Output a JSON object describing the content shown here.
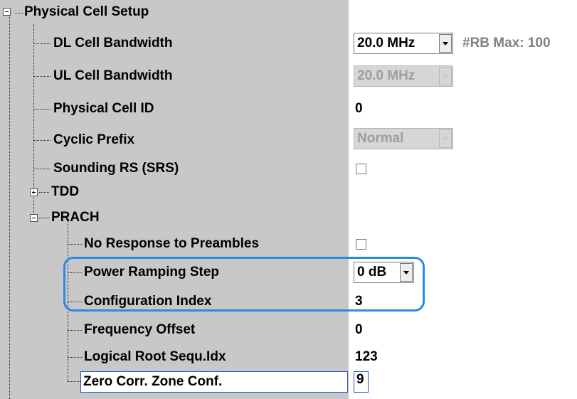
{
  "tree": {
    "root": {
      "label": "Physical Cell Setup",
      "expanded": true
    },
    "rows": [
      {
        "key": "dl_bw",
        "label": "DL Cell Bandwidth",
        "control": "combo",
        "value": "20.0 MHz",
        "enabled": true
      },
      {
        "key": "ul_bw",
        "label": "UL Cell Bandwidth",
        "control": "combo",
        "value": "20.0 MHz",
        "enabled": false
      },
      {
        "key": "cell_id",
        "label": "Physical Cell ID",
        "control": "text",
        "value": "0"
      },
      {
        "key": "cp",
        "label": "Cyclic Prefix",
        "control": "combo",
        "value": "Normal",
        "enabled": false
      },
      {
        "key": "srs",
        "label": "Sounding RS (SRS)",
        "control": "checkbox",
        "checked": false
      },
      {
        "key": "tdd",
        "label": "TDD",
        "node": "collapsed"
      },
      {
        "key": "prach",
        "label": "PRACH",
        "node": "expanded"
      },
      {
        "key": "no_resp",
        "label": "No Response to Preambles",
        "control": "checkbox",
        "checked": false
      },
      {
        "key": "ramp",
        "label": "Power Ramping Step",
        "control": "combo",
        "value": "0 dB",
        "enabled": true
      },
      {
        "key": "cfg_idx",
        "label": "Configuration Index",
        "control": "text",
        "value": "3"
      },
      {
        "key": "freq_off",
        "label": "Frequency Offset",
        "control": "text",
        "value": "0"
      },
      {
        "key": "root_idx",
        "label": "Logical Root Sequ.Idx",
        "control": "text",
        "value": "123"
      },
      {
        "key": "zero_corr",
        "label": "Zero Corr. Zone Conf.",
        "control": "edit",
        "value": "9",
        "selected": true
      }
    ]
  },
  "rb_max": "#RB Max:  100",
  "colors": {
    "pane": "#c8c8c8",
    "highlight": "#2a8ae8",
    "selection": "#2255cc",
    "rb_max": "#808080"
  }
}
